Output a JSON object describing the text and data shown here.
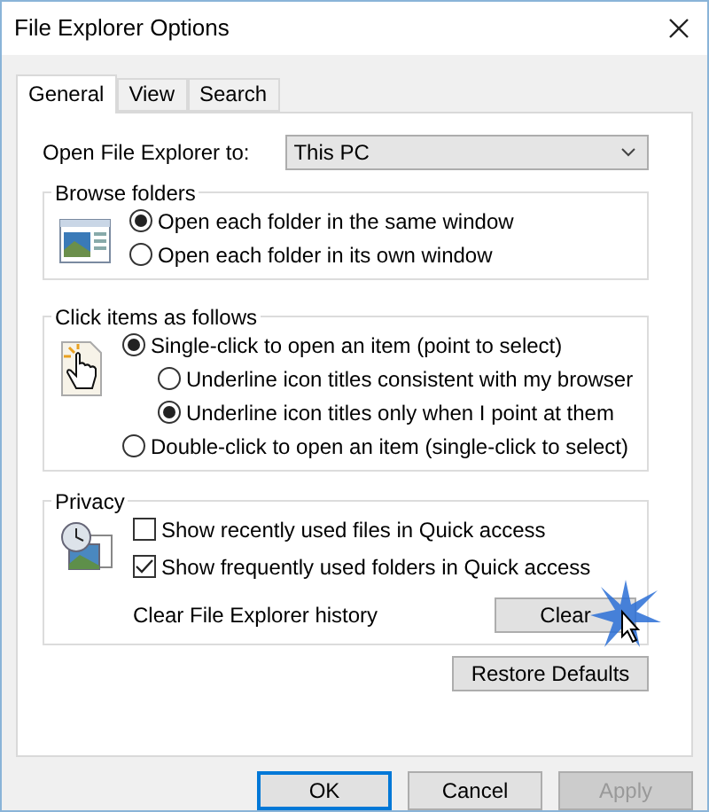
{
  "window": {
    "title": "File Explorer Options"
  },
  "tabs": [
    {
      "label": "General",
      "selected": true
    },
    {
      "label": "View",
      "selected": false
    },
    {
      "label": "Search",
      "selected": false
    }
  ],
  "open_to": {
    "label": "Open File Explorer to:",
    "value": "This PC"
  },
  "browse_folders": {
    "title": "Browse folders",
    "options": [
      {
        "label": "Open each folder in the same window",
        "selected": true
      },
      {
        "label": "Open each folder in its own window",
        "selected": false
      }
    ]
  },
  "click_items": {
    "title": "Click items as follows",
    "options": [
      {
        "label": "Single-click to open an item (point to select)",
        "selected": true,
        "children": [
          {
            "label": "Underline icon titles consistent with my browser",
            "selected": false
          },
          {
            "label": "Underline icon titles only when I point at them",
            "selected": true
          }
        ]
      },
      {
        "label": "Double-click to open an item (single-click to select)",
        "selected": false
      }
    ]
  },
  "privacy": {
    "title": "Privacy",
    "checkboxes": [
      {
        "label": "Show recently used files in Quick access",
        "checked": false
      },
      {
        "label": "Show frequently used folders in Quick access",
        "checked": true
      }
    ],
    "history_label": "Clear File Explorer history",
    "clear_button": "Clear"
  },
  "restore_button": "Restore Defaults",
  "buttons": [
    {
      "label": "OK",
      "default": true,
      "disabled": false
    },
    {
      "label": "Cancel",
      "default": false,
      "disabled": false
    },
    {
      "label": "Apply",
      "default": false,
      "disabled": true
    }
  ]
}
